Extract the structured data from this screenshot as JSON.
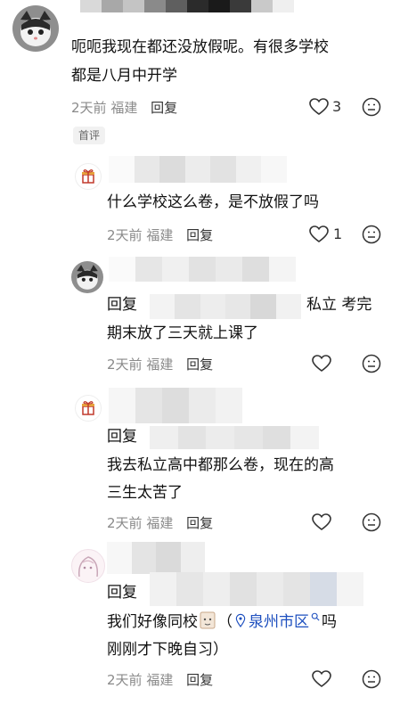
{
  "comments": [
    {
      "text_lines": [
        "呃呃我现在都还没放假呢。有很多学校",
        "都是八月中开学"
      ],
      "time": "2天前",
      "region": "福建",
      "reply_label": "回复",
      "likes": "3",
      "tag": "首评"
    },
    {
      "text_lines": [
        "什么学校这么卷，是不放假了吗"
      ],
      "time": "2天前",
      "region": "福建",
      "reply_label": "回复",
      "likes": "1"
    },
    {
      "reply_prefix": "回复",
      "reply_suffix": "私立 考完",
      "text_lines": [
        "期末放了三天就上课了"
      ],
      "time": "2天前",
      "region": "福建",
      "reply_label": "回复"
    },
    {
      "reply_prefix": "回复",
      "text_lines": [
        "我去私立高中都那么卷，现在的高",
        "三生太苦了"
      ],
      "time": "2天前",
      "region": "福建",
      "reply_label": "回复"
    },
    {
      "reply_prefix": "回复",
      "text_part1": "我们好像同校",
      "text_location": "泉州市区",
      "text_part2": "吗",
      "text_line2": "刚刚才下晚自习）",
      "time": "2天前",
      "region": "福建",
      "reply_label": "回复"
    }
  ]
}
